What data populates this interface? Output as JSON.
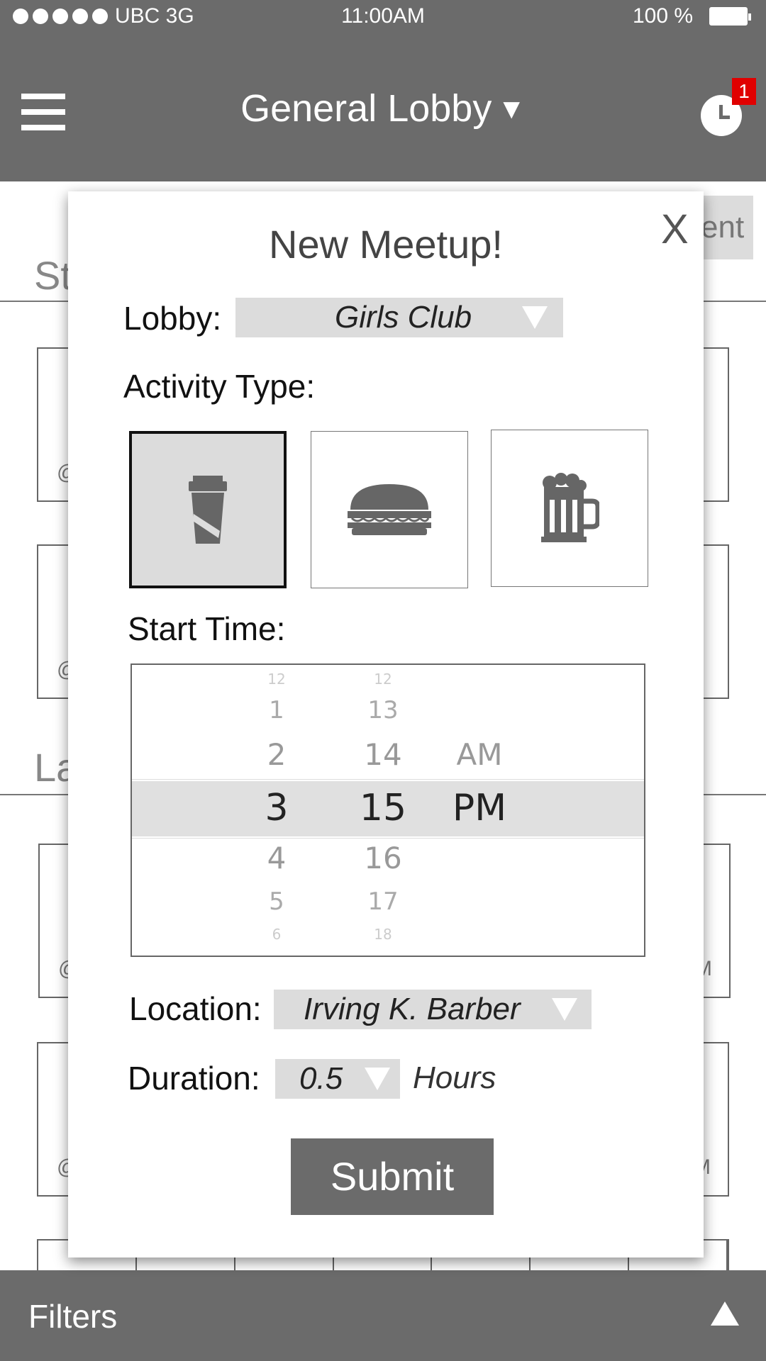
{
  "status_bar": {
    "carrier": "UBC  3G",
    "time": "11:00AM",
    "battery": "100 %"
  },
  "header": {
    "title": "General Lobby",
    "title_arrow": "▼",
    "notifications": "1"
  },
  "background": {
    "tab_fragment": "ent",
    "section1_fragment": "St",
    "section2_fragment": "La",
    "card_at": "@",
    "card_pm_fragment": "M"
  },
  "modal": {
    "close": "X",
    "title": "New Meetup!",
    "lobby_label": "Lobby:",
    "lobby_value": "Girls Club",
    "activity_label": "Activity Type:",
    "activities": [
      {
        "icon": "coffee-cup-icon",
        "selected": true
      },
      {
        "icon": "burger-icon",
        "selected": false
      },
      {
        "icon": "beer-mug-icon",
        "selected": false
      }
    ],
    "start_time_label": "Start Time:",
    "picker": {
      "hours": [
        "12",
        "1",
        "2",
        "3",
        "4",
        "5",
        "6"
      ],
      "minutes": [
        "12",
        "13",
        "14",
        "15",
        "16",
        "17",
        "18"
      ],
      "ampm": [
        "AM",
        "PM"
      ],
      "selected": {
        "hour": "3",
        "minute": "15",
        "ampm": "PM"
      }
    },
    "location_label": "Location:",
    "location_value": "Irving K. Barber",
    "duration_label": "Duration:",
    "duration_value": "0.5",
    "duration_unit": "Hours",
    "submit_label": "Submit"
  },
  "footer": {
    "filters_label": "Filters"
  },
  "colors": {
    "bar": "#6b6b6b",
    "badge": "#e00000",
    "field": "#dcdcdc"
  }
}
